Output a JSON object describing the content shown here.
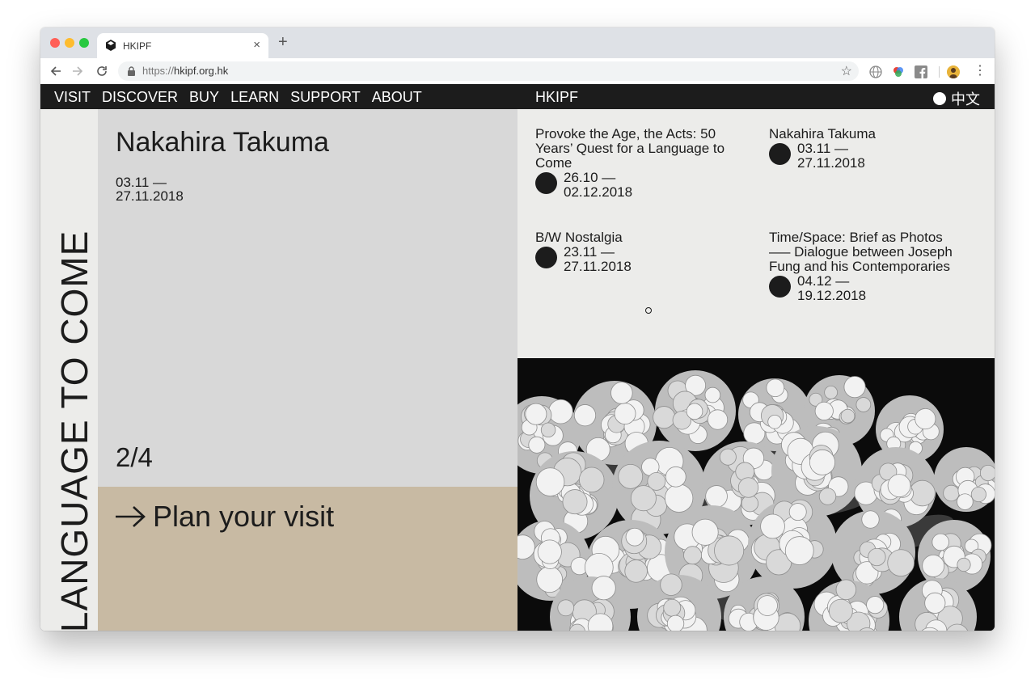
{
  "browser": {
    "tab_title": "HKIPF",
    "new_tab": "+",
    "tab_close": "×",
    "url_scheme": "https://",
    "url_host": "hkipf.org.hk"
  },
  "site": {
    "nav": [
      "VISIT",
      "DISCOVER",
      "BUY",
      "LEARN",
      "SUPPORT",
      "ABOUT"
    ],
    "logo": "HKIPF",
    "language": "中文",
    "banner": "A LANGUAGE TO COME",
    "feature": {
      "title": "Nakahira Takuma",
      "dates": "03.11 — 27.11.2018",
      "counter": "2/4"
    },
    "cta": "Plan your visit",
    "exhibitions": [
      {
        "title": "Provoke the Age, the Acts: 50 Years’ Quest for a Language to Come",
        "dates": "26.10 — 02.12.2018"
      },
      {
        "title": "Nakahira Takuma",
        "dates": "03.11 — 27.11.2018"
      },
      {
        "title": "B/W Nostalgia",
        "dates": "23.11 — 27.11.2018"
      },
      {
        "title": "Time/Space: Brief as Photos —– Dialogue between Joseph Fung and his Contemporaries",
        "dates": "04.12 — 19.12.2018"
      }
    ]
  },
  "colors": {
    "nav_bg": "#1c1c1c",
    "feature_bg": "#d8d8d8",
    "cta_bg": "#c8baa3",
    "panel_bg": "#ececea"
  }
}
